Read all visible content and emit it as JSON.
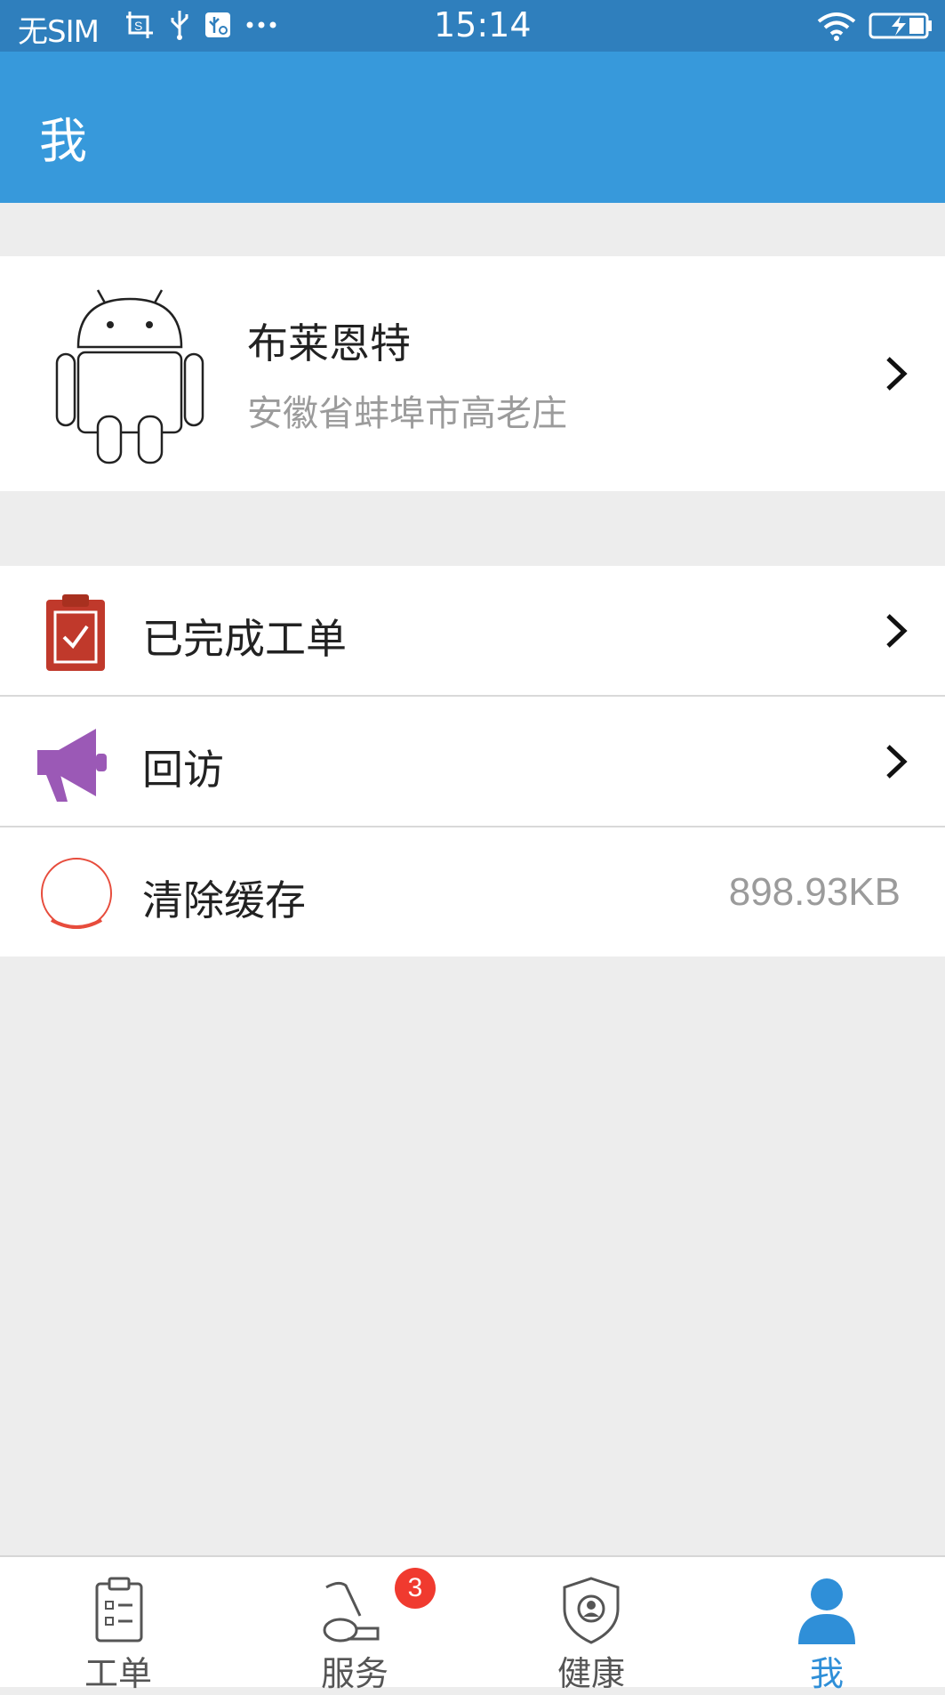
{
  "status_bar": {
    "carrier": "无SIM",
    "time": "15:14",
    "icons": [
      "screenshot-icon",
      "usb-icon",
      "usb-debug-icon",
      "more-dots-icon",
      "wifi-icon",
      "battery-charging-icon"
    ]
  },
  "header": {
    "title": "我"
  },
  "profile": {
    "name": "布莱恩特",
    "address": "安徽省蚌埠市高老庄",
    "avatar_icon": "android-robot-icon"
  },
  "menu": {
    "items": [
      {
        "label": "已完成工单",
        "icon": "clipboard-check-icon",
        "icon_color": "#c0392b"
      },
      {
        "label": "回访",
        "icon": "megaphone-icon",
        "icon_color": "#9b59b6"
      },
      {
        "label": "清除缓存",
        "icon": "circle-icon",
        "icon_color": "#e74c3c",
        "value": "898.93KB"
      }
    ]
  },
  "tabbar": {
    "tabs": [
      {
        "label": "工单",
        "icon": "clipboard-list-icon",
        "active": false
      },
      {
        "label": "服务",
        "icon": "vacuum-cleaner-icon",
        "active": false,
        "badge": "3"
      },
      {
        "label": "健康",
        "icon": "shield-user-icon",
        "active": false
      },
      {
        "label": "我",
        "icon": "user-icon",
        "active": true
      }
    ]
  },
  "colors": {
    "status_bar": "#2f7fbd",
    "app_bar": "#3799db",
    "background": "#ededed",
    "active_tab": "#2f8fd8",
    "badge": "#f03a2f"
  }
}
